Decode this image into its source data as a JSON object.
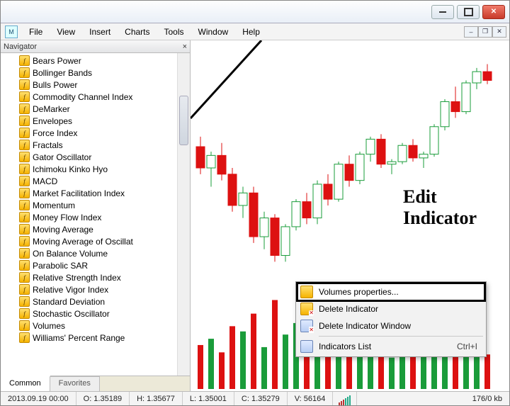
{
  "menu": {
    "items": [
      "File",
      "View",
      "Insert",
      "Charts",
      "Tools",
      "Window",
      "Help"
    ]
  },
  "navigator": {
    "title": "Navigator",
    "tabs": {
      "active": "Common",
      "inactive": "Favorites"
    },
    "items": [
      "Bears Power",
      "Bollinger Bands",
      "Bulls Power",
      "Commodity Channel Index",
      "DeMarker",
      "Envelopes",
      "Force Index",
      "Fractals",
      "Gator Oscillator",
      "Ichimoku Kinko Hyo",
      "MACD",
      "Market Facilitation Index",
      "Momentum",
      "Money Flow Index",
      "Moving Average",
      "Moving Average of Oscillat",
      "On Balance Volume",
      "Parabolic SAR",
      "Relative Strength Index",
      "Relative Vigor Index",
      "Standard Deviation",
      "Stochastic Oscillator",
      "Volumes",
      "Williams' Percent Range"
    ]
  },
  "context_menu": {
    "properties": "Volumes properties...",
    "delete_indicator": "Delete Indicator",
    "delete_window": "Delete Indicator Window",
    "indicators_list": "Indicators List",
    "indicators_list_shortcut": "Ctrl+I"
  },
  "annotation": "Edit Indicator",
  "status": {
    "datetime": "2013.09.19 00:00",
    "open": "O: 1.35189",
    "high": "H: 1.35677",
    "low": "L: 1.35001",
    "close": "C: 1.35279",
    "volume": "V: 56164",
    "net": "176/0 kb"
  },
  "chart_data": {
    "type": "candlestick+volume",
    "note": "values estimated from pixels; no axis labels visible",
    "price_range_est": [
      1.345,
      1.362
    ],
    "candles": [
      {
        "o": 1.3552,
        "h": 1.356,
        "l": 1.353,
        "c": 1.3535,
        "up": false
      },
      {
        "o": 1.3535,
        "h": 1.3548,
        "l": 1.352,
        "c": 1.3545,
        "up": true
      },
      {
        "o": 1.3545,
        "h": 1.3555,
        "l": 1.3525,
        "c": 1.353,
        "up": false
      },
      {
        "o": 1.353,
        "h": 1.3535,
        "l": 1.35,
        "c": 1.3505,
        "up": false
      },
      {
        "o": 1.3505,
        "h": 1.352,
        "l": 1.3495,
        "c": 1.3515,
        "up": true
      },
      {
        "o": 1.3515,
        "h": 1.352,
        "l": 1.3475,
        "c": 1.348,
        "up": false
      },
      {
        "o": 1.348,
        "h": 1.35,
        "l": 1.347,
        "c": 1.3495,
        "up": true
      },
      {
        "o": 1.3495,
        "h": 1.3498,
        "l": 1.346,
        "c": 1.3465,
        "up": false
      },
      {
        "o": 1.3465,
        "h": 1.349,
        "l": 1.346,
        "c": 1.3488,
        "up": true
      },
      {
        "o": 1.3488,
        "h": 1.351,
        "l": 1.3485,
        "c": 1.3508,
        "up": true
      },
      {
        "o": 1.3508,
        "h": 1.3515,
        "l": 1.349,
        "c": 1.3495,
        "up": false
      },
      {
        "o": 1.3495,
        "h": 1.3525,
        "l": 1.349,
        "c": 1.3522,
        "up": true
      },
      {
        "o": 1.3522,
        "h": 1.353,
        "l": 1.3505,
        "c": 1.351,
        "up": false
      },
      {
        "o": 1.351,
        "h": 1.354,
        "l": 1.3508,
        "c": 1.3538,
        "up": true
      },
      {
        "o": 1.3538,
        "h": 1.3545,
        "l": 1.352,
        "c": 1.3525,
        "up": false
      },
      {
        "o": 1.3525,
        "h": 1.3548,
        "l": 1.3522,
        "c": 1.3546,
        "up": true
      },
      {
        "o": 1.3546,
        "h": 1.356,
        "l": 1.354,
        "c": 1.3558,
        "up": true
      },
      {
        "o": 1.3558,
        "h": 1.3562,
        "l": 1.3535,
        "c": 1.3538,
        "up": false
      },
      {
        "o": 1.3538,
        "h": 1.3542,
        "l": 1.353,
        "c": 1.354,
        "up": true
      },
      {
        "o": 1.354,
        "h": 1.3555,
        "l": 1.3538,
        "c": 1.3553,
        "up": true
      },
      {
        "o": 1.3553,
        "h": 1.3558,
        "l": 1.354,
        "c": 1.3543,
        "up": false
      },
      {
        "o": 1.3543,
        "h": 1.3548,
        "l": 1.3535,
        "c": 1.3546,
        "up": true
      },
      {
        "o": 1.3546,
        "h": 1.357,
        "l": 1.3544,
        "c": 1.3568,
        "up": true
      },
      {
        "o": 1.3568,
        "h": 1.359,
        "l": 1.3565,
        "c": 1.3588,
        "up": true
      },
      {
        "o": 1.3588,
        "h": 1.36,
        "l": 1.3575,
        "c": 1.358,
        "up": false
      },
      {
        "o": 1.358,
        "h": 1.3605,
        "l": 1.3578,
        "c": 1.3603,
        "up": true
      },
      {
        "o": 1.3603,
        "h": 1.3615,
        "l": 1.3598,
        "c": 1.3612,
        "up": true
      },
      {
        "o": 1.3612,
        "h": 1.3618,
        "l": 1.3602,
        "c": 1.3605,
        "up": false
      }
    ],
    "volumes": [
      42,
      48,
      35,
      60,
      55,
      72,
      40,
      85,
      52,
      63,
      47,
      70,
      38,
      65,
      44,
      58,
      62,
      35,
      30,
      55,
      41,
      39,
      75,
      88,
      50,
      68,
      60,
      33
    ],
    "volume_color_follows_candle": true
  }
}
